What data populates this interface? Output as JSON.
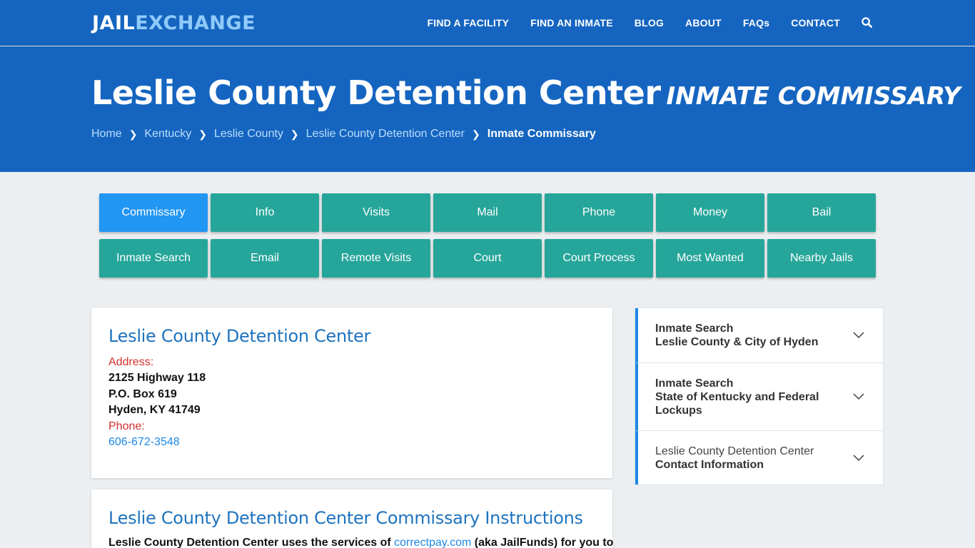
{
  "brand": {
    "part1": "JAIL",
    "part2": "EXCHANGE"
  },
  "nav": {
    "items": [
      "FIND A FACILITY",
      "FIND AN INMATE",
      "BLOG",
      "ABOUT",
      "FAQs",
      "CONTACT"
    ],
    "search_icon": "search-icon"
  },
  "hero": {
    "title": "Leslie County Detention Center",
    "subtitle": "INMATE COMMISSARY",
    "breadcrumbs": [
      "Home",
      "Kentucky",
      "Leslie County",
      "Leslie County Detention Center"
    ],
    "current": "Inmate Commissary"
  },
  "tabs": {
    "row1": [
      "Commissary",
      "Info",
      "Visits",
      "Mail",
      "Phone",
      "Money",
      "Bail"
    ],
    "row2": [
      "Inmate Search",
      "Email",
      "Remote Visits",
      "Court",
      "Court Process",
      "Most Wanted",
      "Nearby Jails"
    ],
    "active": "Commissary"
  },
  "facility": {
    "name": "Leslie County Detention Center",
    "address_label": "Address:",
    "address_line1": "2125 Highway 118",
    "address_line2": "P.O. Box 619",
    "address_line3": "Hyden, KY 41749",
    "phone_label": "Phone:",
    "phone": "606-672-3548"
  },
  "instructions": {
    "title": "Leslie County Detention Center Commissary Instructions",
    "text_before": "Leslie County Detention Center uses the services of ",
    "link": "correctpay.com",
    "text_after": " (aka JailFunds) for you to"
  },
  "accordion": [
    {
      "line1": "Inmate Search",
      "line2": "Leslie County & City of Hyden"
    },
    {
      "line1": "Inmate Search",
      "line2": "State of Kentucky and Federal Lockups"
    },
    {
      "line1": "Leslie County Detention Center",
      "line2": "Contact Information"
    }
  ],
  "colors": {
    "header": "#1565c0",
    "tab": "#26a69a",
    "tab_active": "#2196f3",
    "link": "#1e88e5",
    "label": "#d32f2f"
  }
}
